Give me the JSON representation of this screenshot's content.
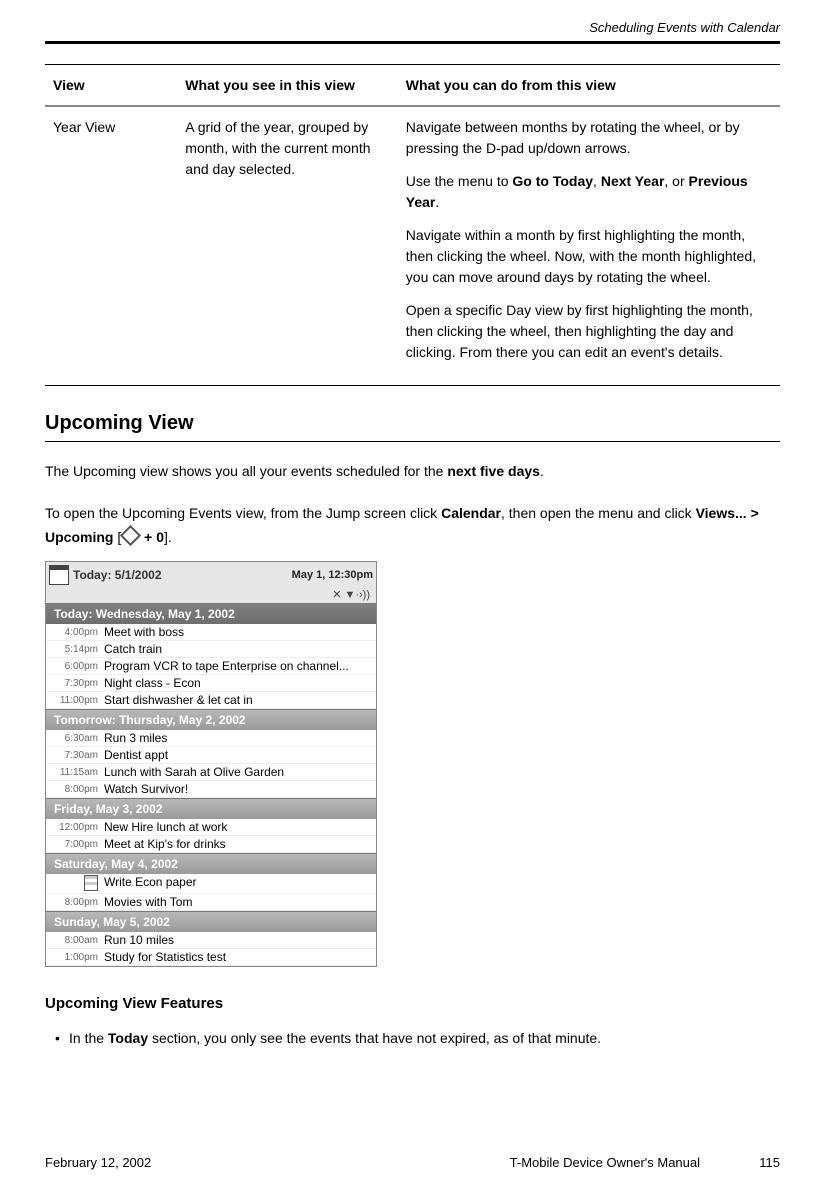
{
  "header": {
    "section": "Scheduling Events with Calendar"
  },
  "table": {
    "headers": [
      "View",
      "What you see in this view",
      "What you can do from this view"
    ],
    "rows": [
      {
        "view": "Year View",
        "see": "A grid of the year, grouped by month, with the current month and day selected.",
        "do": [
          {
            "pre": "Navigate between months by rotating the wheel, or by pressing the D-pad up/down arrows."
          },
          {
            "pre": "Use the menu to ",
            "b1": "Go to Today",
            "m1": ", ",
            "b2": "Next Year",
            "m2": ", or ",
            "b3": "Previous Year",
            "post": "."
          },
          {
            "pre": "Navigate within a month by first highlighting the month, then clicking the wheel. Now, with the month highlighted, you can move around days by rotating the wheel."
          },
          {
            "pre": "Open a specific Day view by first highlighting the month, then clicking the wheel, then highlighting the day and clicking. From there you can edit an event's details."
          }
        ]
      }
    ]
  },
  "section1": {
    "title": "Upcoming View"
  },
  "para1": {
    "pre": "The Upcoming view shows you all your events scheduled for the ",
    "bold": "next five days",
    "post": "."
  },
  "para2": {
    "pre": "To open the Upcoming Events view, from the Jump screen click ",
    "b1": "Calendar",
    "m1": ", then open the menu and click ",
    "b2": "Views... > Upcoming",
    "m2": " [",
    "b3": " + 0",
    "post": "]."
  },
  "screenshot": {
    "today_label": "Today: 5/1/2002",
    "status_time": "May 1, 12:30pm",
    "status_icons": "✕  ▼·›))",
    "days": [
      {
        "header": "Today: Wednesday, May 1, 2002",
        "events": [
          {
            "time": "4:00pm",
            "title": "Meet with boss"
          },
          {
            "time": "5:14pm",
            "title": "Catch train"
          },
          {
            "time": "6:00pm",
            "title": "Program VCR to tape Enterprise on channel..."
          },
          {
            "time": "7:30pm",
            "title": "Night class - Econ"
          },
          {
            "time": "11:00pm",
            "title": "Start dishwasher & let cat in"
          }
        ]
      },
      {
        "header": "Tomorrow: Thursday, May 2, 2002",
        "events": [
          {
            "time": "6:30am",
            "title": "Run 3 miles"
          },
          {
            "time": "7:30am",
            "title": "Dentist appt"
          },
          {
            "time": "11:15am",
            "title": "Lunch with Sarah at Olive Garden"
          },
          {
            "time": "8:00pm",
            "title": "Watch Survivor!"
          }
        ]
      },
      {
        "header": "Friday, May 3, 2002",
        "events": [
          {
            "time": "12:00pm",
            "title": "New Hire lunch at work"
          },
          {
            "time": "7:00pm",
            "title": "Meet at Kip's for drinks"
          }
        ]
      },
      {
        "header": "Saturday, May 4, 2002",
        "events": [
          {
            "icon": true,
            "title": "Write Econ paper"
          },
          {
            "time": "8:00pm",
            "title": "Movies with Tom"
          }
        ]
      },
      {
        "header": "Sunday, May 5, 2002",
        "events": [
          {
            "time": "8:00am",
            "title": "Run 10 miles"
          },
          {
            "time": "1:00pm",
            "title": "Study for Statistics test"
          }
        ]
      }
    ]
  },
  "section2": {
    "title": "Upcoming View Features"
  },
  "feature1": {
    "pre": "In the ",
    "bold": "Today",
    "post": " section, you only see the events that have not expired, as of that minute."
  },
  "footer": {
    "date": "February 12, 2002",
    "book": "T-Mobile Device Owner's Manual",
    "page": "115"
  }
}
